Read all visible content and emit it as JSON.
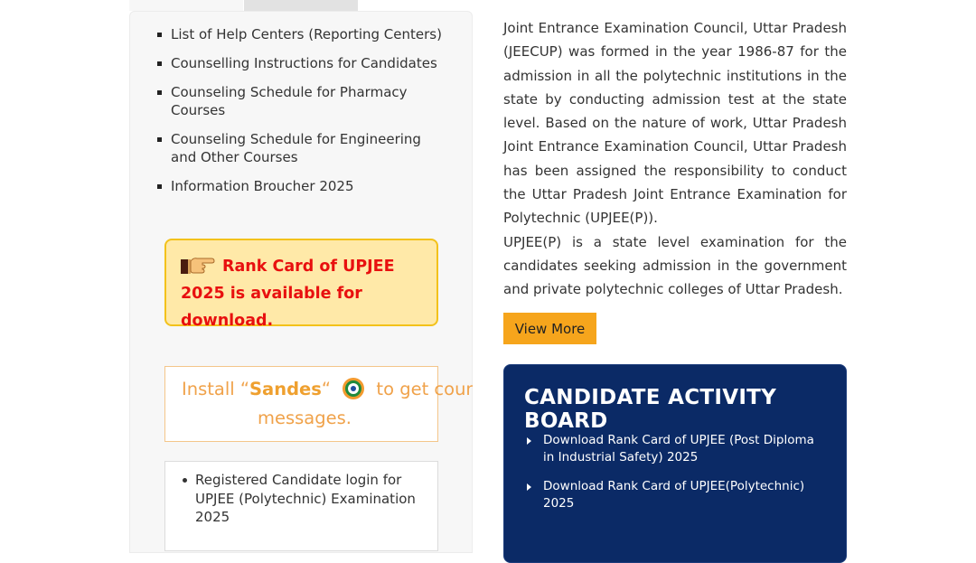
{
  "sidebar": {
    "links": [
      "List of Help Centers (Reporting Centers)",
      "Counselling Instructions for Candidates",
      "Counseling Schedule for Pharmacy Courses",
      "Counseling Schedule for Engineering and Other Courses",
      "Information Broucher 2025"
    ],
    "rank_notice": "Rank Card of UPJEE 2025 is available for download.",
    "sandes": {
      "prefix": "Install “",
      "app_name": "Sandes",
      "suffix_quote": "“",
      "line1_rest": "to get counselli",
      "line2": "messages."
    },
    "login_links": [
      "Registered Candidate login for UPJEE (Polytechnic) Examination 2025"
    ]
  },
  "about": {
    "paragraph1": "Joint Entrance Examination Council, Uttar Pradesh (JEECUP) was formed in the year 1986-87 for the admission in all the polytechnic institutions in the state by conducting admission test at the state level. Based on the nature of work, Uttar Pradesh Joint Entrance Examination Council, Uttar Pradesh has been assigned the responsibility to conduct the Uttar Pradesh Joint Entrance Examination for Polytechnic (UPJEE(P)).",
    "paragraph2": "UPJEE(P) is a state level examination for the candidates seeking admission in the government and private polytechnic colleges of Uttar Pradesh.",
    "view_more_label": "View More"
  },
  "activity_board": {
    "title": "CANDIDATE ACTIVITY BOARD",
    "items": [
      "Download Rank Card of UPJEE (Post Diploma in Industrial Safety) 2025",
      "Download Rank Card of UPJEE(Polytechnic) 2025"
    ]
  },
  "colors": {
    "notice_text": "#e8100f",
    "notice_bg": "#ffe9a8",
    "sandes_text": "#f0a24a",
    "button_bg": "#f6a51c",
    "board_bg": "#0b2a66"
  },
  "icons": {
    "notice": "pointing-hand-icon",
    "sandes": "sandes-logo-icon",
    "link_bullet": "square-bullet-icon",
    "board_bullet": "triangle-bullet-icon"
  }
}
